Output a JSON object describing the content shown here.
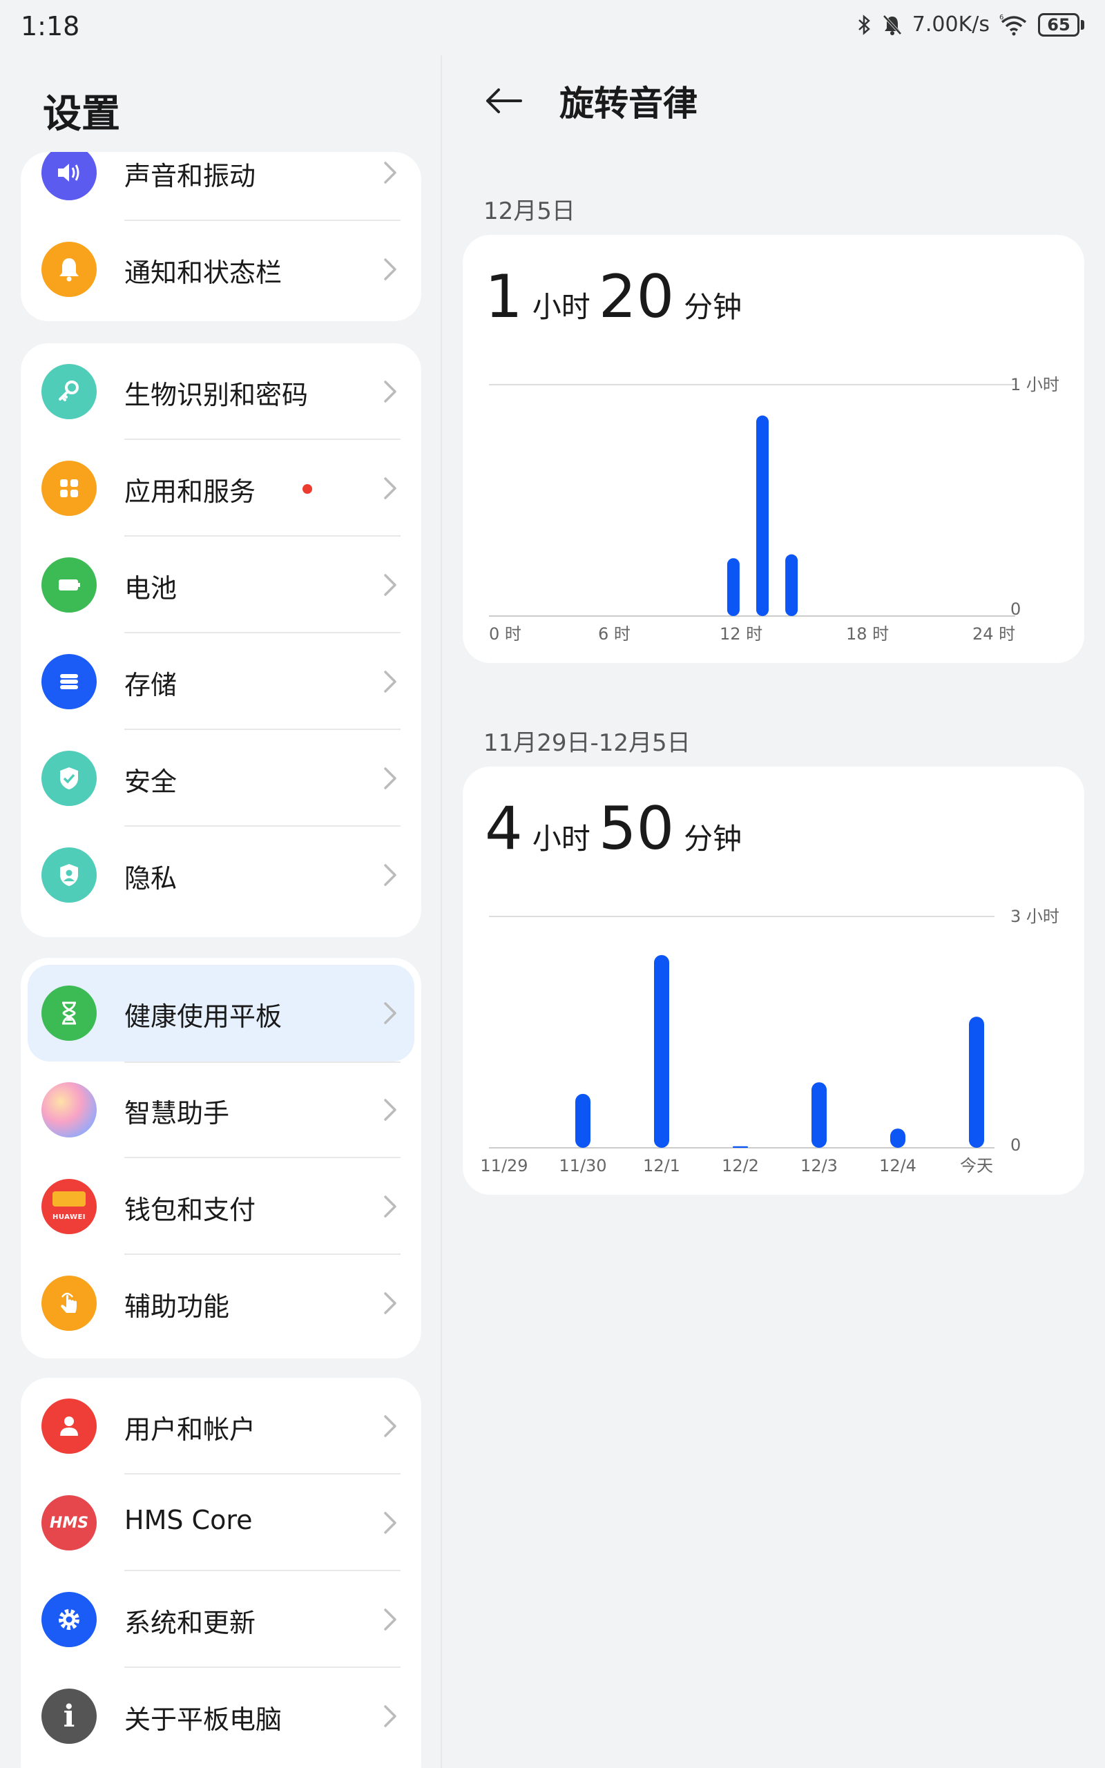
{
  "status_bar": {
    "time": "1:18",
    "network_speed": "7.00K/s",
    "battery": "65",
    "icons": [
      "bluetooth-icon",
      "mute-icon",
      "wifi-icon",
      "battery-icon"
    ]
  },
  "settings": {
    "title": "设置",
    "groups": [
      {
        "items": [
          {
            "label": "声音和振动",
            "icon": "speaker-icon",
            "color": "#5b5bf0"
          },
          {
            "label": "通知和状态栏",
            "icon": "bell-icon",
            "color": "#f9a21b"
          }
        ]
      },
      {
        "items": [
          {
            "label": "生物识别和密码",
            "icon": "key-icon",
            "color": "#4fcdb9"
          },
          {
            "label": "应用和服务",
            "icon": "apps-icon",
            "color": "#f9a21b",
            "badge": "red-dot"
          },
          {
            "label": "电池",
            "icon": "battery-icon",
            "color": "#3cba54"
          },
          {
            "label": "存储",
            "icon": "storage-icon",
            "color": "#1a5cf5"
          },
          {
            "label": "安全",
            "icon": "shield-check-icon",
            "color": "#4fcdb9"
          },
          {
            "label": "隐私",
            "icon": "privacy-icon",
            "color": "#4fcdb9"
          }
        ]
      },
      {
        "items": [
          {
            "label": "健康使用平板",
            "icon": "hourglass-icon",
            "color": "#3cba54",
            "selected": true
          },
          {
            "label": "智慧助手",
            "icon": "assistant-icon",
            "color": "#f28cbf"
          },
          {
            "label": "钱包和支付",
            "icon": "wallet-icon",
            "color": "#ef3e37",
            "icon_text": "HUAWEI"
          },
          {
            "label": "辅助功能",
            "icon": "hand-icon",
            "color": "#f9a21b"
          }
        ]
      },
      {
        "items": [
          {
            "label": "用户和帐户",
            "icon": "user-icon",
            "color": "#ef3e37"
          },
          {
            "label": "HMS Core",
            "icon": "hms-icon",
            "color": "#e5474c",
            "icon_text": "HMS"
          },
          {
            "label": "系统和更新",
            "icon": "gear-icon",
            "color": "#1a5cf5"
          },
          {
            "label": "关于平板电脑",
            "icon": "info-icon",
            "color": "#555555",
            "icon_text": "i"
          }
        ]
      }
    ]
  },
  "detail": {
    "title": "旋转音律",
    "daily": {
      "date": "12月5日",
      "hours": "1",
      "hours_unit": "小时",
      "minutes": "20",
      "minutes_unit": "分钟"
    },
    "weekly": {
      "date": "11月29日-12月5日",
      "hours": "4",
      "hours_unit": "小时",
      "minutes": "50",
      "minutes_unit": "分钟"
    }
  },
  "chart_data": [
    {
      "type": "bar",
      "title": "",
      "x_ticks": [
        "0 时",
        "6 时",
        "12 时",
        "18 时",
        "24 时"
      ],
      "y_max_label": "1 小时",
      "y_min_label": "0",
      "ylim_minutes": [
        0,
        60
      ],
      "series": [
        {
          "x_hour": [
            11,
            12,
            13
          ],
          "values_minutes": [
            15,
            52,
            16
          ]
        }
      ],
      "color": "#0b56f5",
      "grid": true
    },
    {
      "type": "bar",
      "title": "",
      "categories": [
        "11/29",
        "11/30",
        "12/1",
        "12/2",
        "12/3",
        "12/4",
        "今天"
      ],
      "values_hours": [
        0,
        0.7,
        2.5,
        0.02,
        0.85,
        0.25,
        1.7
      ],
      "y_max_label": "3 小时",
      "y_min_label": "0",
      "ylim_hours": [
        0,
        3
      ],
      "color": "#0b56f5",
      "grid": true
    }
  ]
}
